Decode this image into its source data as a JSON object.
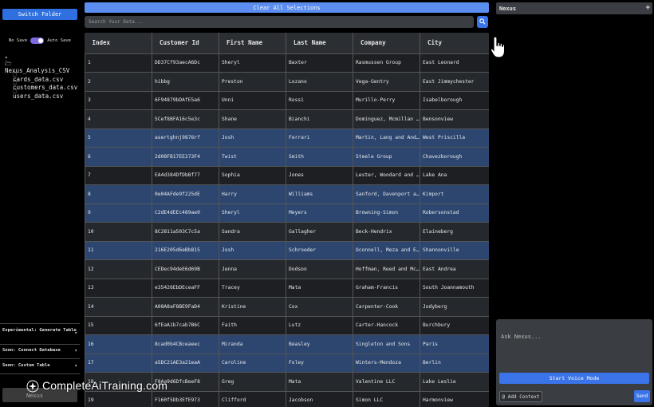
{
  "sidebar": {
    "switch_folder_label": "Switch Folder",
    "no_save_label": "No Save",
    "auto_save_label": "Auto Save",
    "folder_name": "Nexus_Analysis_CSV",
    "files": [
      "cards_data.csv",
      "customers_data.csv",
      "users_data.csv"
    ],
    "menu": [
      {
        "label": "Experimental: Generate Table"
      },
      {
        "label": "Soon: Connect Database"
      },
      {
        "label": "Soon: Custom Table"
      }
    ],
    "bottom_label": "Nexus"
  },
  "main": {
    "clear_label": "Clear All Selections",
    "search_placeholder": "Search Your Data...",
    "columns": [
      "Index",
      "Customer Id",
      "First Name",
      "Last Name",
      "Company",
      "City"
    ],
    "rows": [
      [
        "1",
        "DD37Cf93aecA6Dc",
        "Sheryl",
        "Baxter",
        "Rasmussen Group",
        "East Leonard"
      ],
      [
        "2",
        "hibbg",
        "Preston",
        "Lozano",
        "Vega-Gentry",
        "East Jimmychester"
      ],
      [
        "3",
        "6F94879bDAfE5a6",
        "Unni",
        "Rossi",
        "Murillo-Perry",
        "Isabelborough"
      ],
      [
        "4",
        "5Cef8BFA16c5e3c",
        "Shane",
        "Bianchi",
        "Dominguez, Mcmillan and Donovan",
        "Bensonview"
      ],
      [
        "5",
        "asertghnj9876rf",
        "Josh",
        "Ferrari",
        "Martin, Lang and Andrade",
        "West Priscilla"
      ],
      [
        "6",
        "2d08FB17EE273F4",
        "Twist",
        "Smith",
        "Steele Group",
        "Chavezborough"
      ],
      [
        "7",
        "EA4d384DfDbBf77",
        "Sophia",
        "Jones",
        "Lester, Woodard and Mitchell",
        "Lake Ana"
      ],
      [
        "8",
        "0e04AFde9f225dE",
        "Harry",
        "Williams",
        "Sanford, Davenport and Giles",
        "Kimport"
      ],
      [
        "9",
        "C2dE4dEEc489ae0",
        "Sheryl",
        "Meyers",
        "Browning-Simon",
        "Robersonstad"
      ],
      [
        "10",
        "8C2811a503C7c5a",
        "Sandra",
        "Gallagher",
        "Beck-Hendrix",
        "Elaineberg"
      ],
      [
        "11",
        "216E205d6eBb815",
        "Josh",
        "Schroeder",
        "Oconnell, Meza and Everett",
        "Shannonville"
      ],
      [
        "12",
        "CEDec94deE6d69B",
        "Jenna",
        "Dodson",
        "Hoffman, Reed and Mcclain",
        "East Andrea"
      ],
      [
        "13",
        "e35426EbDEceaFF",
        "Tracey",
        "Mata",
        "Graham-Francis",
        "South Joannamouth"
      ],
      [
        "14",
        "A08A8aF8BE9FaD4",
        "Kristine",
        "Cox",
        "Carpenter-Cook",
        "Jodyberg"
      ],
      [
        "15",
        "6fEaA1b7cab7B6C",
        "Faith",
        "Lutz",
        "Carter-Hancock",
        "Burchbury"
      ],
      [
        "16",
        "8cad0b4CBceaeec",
        "Miranda",
        "Beasley",
        "Singleton and Sons",
        "Paris"
      ],
      [
        "17",
        "a5DC21AE3a21eaA",
        "Caroline",
        "Foley",
        "Winters-Mendoza",
        "Berlin"
      ],
      [
        "18",
        "F8Aa9d6DfcBeeF8",
        "Greg",
        "Mata",
        "Valentine LLC",
        "Lake Leslie"
      ],
      [
        "19",
        "F160f5Db3EfE973",
        "Clifford",
        "Jacobson",
        "Simon LLC",
        "Harmonview"
      ]
    ],
    "selected_rows": [
      5,
      6,
      8,
      9,
      11,
      16,
      17
    ]
  },
  "right": {
    "panel_title": "Nexus",
    "chat_placeholder": "Ask Nexus...",
    "voice_label": "Start Voice Mode",
    "context_label": "@ Add Context",
    "send_label": "Send"
  },
  "watermark": "CompleteAiTraining.com",
  "colors": {
    "accent": "#3b74e8",
    "clear_button": "#5b8ef0",
    "selected_row": "#2c4670",
    "toggle": "#7a6be0"
  }
}
